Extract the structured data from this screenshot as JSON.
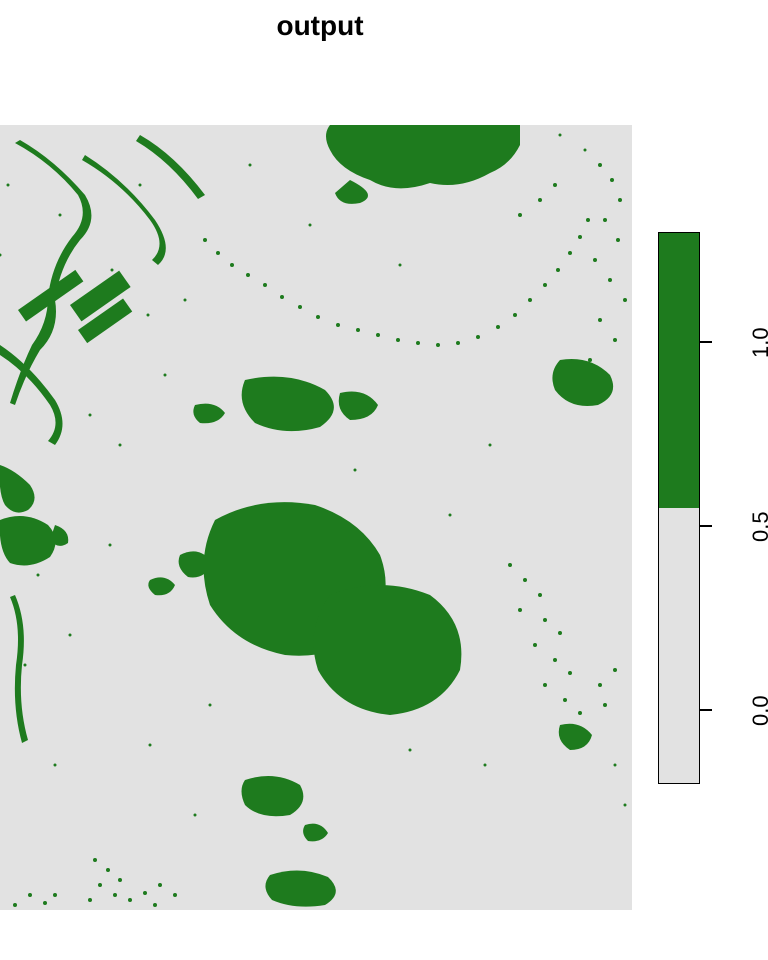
{
  "chart_data": {
    "type": "heatmap",
    "title": "output",
    "xlabel": "",
    "ylabel": "",
    "colormap": {
      "low": "#e2e2e2",
      "high": "#1e7b1e"
    },
    "legend_range": [
      -0.2,
      1.3
    ],
    "legend_ticks": [
      0.0,
      0.5,
      1.0
    ],
    "legend_tick_labels": [
      "0.0",
      "0.5",
      "1.0"
    ],
    "values": "binary raster (0/1) — irregular spatial pattern, not tabulated",
    "axes_visible": false
  },
  "colors": {
    "bg": "#e2e2e2",
    "fg": "#1e7b1e"
  }
}
